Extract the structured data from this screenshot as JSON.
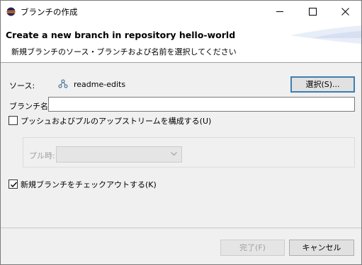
{
  "window": {
    "title": "ブランチの作成",
    "icon": "eclipse-icon"
  },
  "banner": {
    "title": "Create a new branch in repository hello-world",
    "description": "新規ブランチのソース・ブランチおよび名前を選択してください"
  },
  "form": {
    "source_label": "ソース:",
    "source_icon": "branch-icon",
    "source_value": "readme-edits",
    "select_button": "選択(S)...",
    "branch_name_label": "ブランチ名(B):",
    "branch_name_value": "",
    "push_pull_checkbox": {
      "label": "プッシュおよびプルのアップストリームを構成する(U)",
      "checked": false
    },
    "pull_label": "プル時:",
    "pull_value": "",
    "checkout_checkbox": {
      "label": "新規ブランチをチェックアウトする(K)",
      "checked": true
    }
  },
  "footer": {
    "finish_button": "完了(F)",
    "cancel_button": "キャンセル"
  },
  "colors": {
    "focus_border": "#3c7fb1",
    "disabled_text": "#a0a0a0"
  }
}
